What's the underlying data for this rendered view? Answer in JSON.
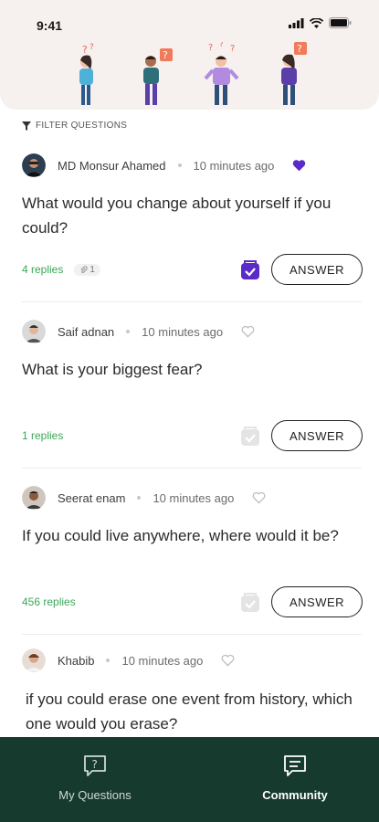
{
  "status_bar": {
    "time": "9:41"
  },
  "filter": {
    "label": "FILTER QUESTIONS",
    "icon": "funnel-icon"
  },
  "questions": [
    {
      "author": "MD Monsur Ahamed",
      "time": "10 minutes ago",
      "liked": true,
      "text": "What would you change about yourself if you could?",
      "replies": "4 replies",
      "attachments": "1",
      "saved": true,
      "answer_label": "ANSWER"
    },
    {
      "author": "Saif adnan",
      "time": "10 minutes ago",
      "liked": false,
      "text": "What is your biggest fear?",
      "replies": "1 replies",
      "saved": false,
      "answer_label": "ANSWER"
    },
    {
      "author": "Seerat enam",
      "time": "10 minutes ago",
      "liked": false,
      "text": "If you could live anywhere, where would it be?",
      "replies": "456 replies",
      "saved": false,
      "answer_label": "ANSWER"
    },
    {
      "author": "Khabib",
      "time": "10 minutes ago",
      "liked": false,
      "text": "if you could erase one event from history, which one would you erase?"
    }
  ],
  "bottom_nav": {
    "items": [
      {
        "label": "My Questions",
        "icon": "question-bubble-icon",
        "active": false
      },
      {
        "label": "Community",
        "icon": "chat-bubble-icon",
        "active": true
      }
    ]
  },
  "colors": {
    "accent": "#5b2bc9",
    "replies_green": "#3aa857",
    "nav_bg": "#173a2f",
    "hero_bg": "#f6f0ef"
  }
}
